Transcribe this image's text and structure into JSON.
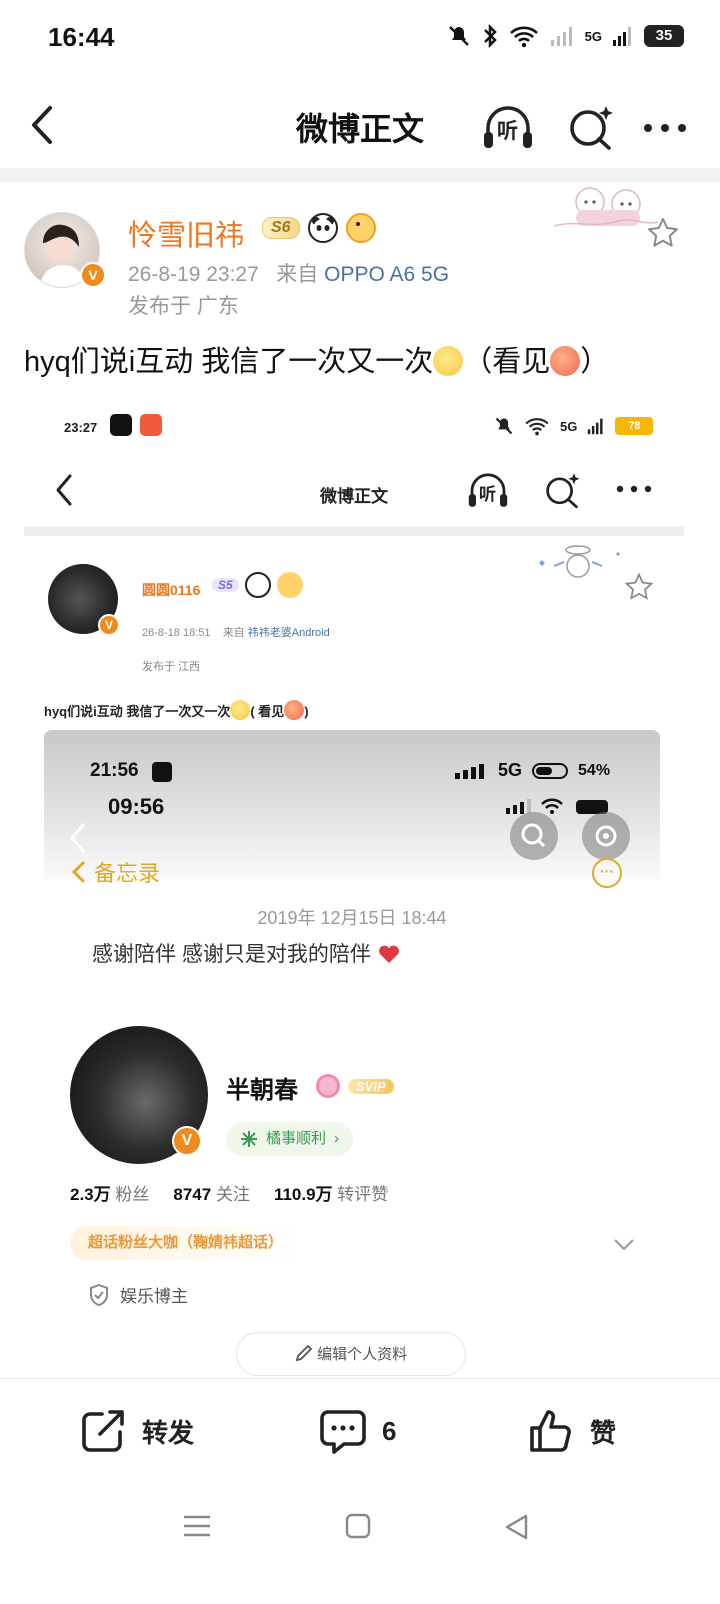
{
  "status_bar": {
    "time": "16:44",
    "network": "5G",
    "battery": "35"
  },
  "nav": {
    "title": "微博正文",
    "listen_label": "听"
  },
  "post": {
    "username": "怜雪旧祎",
    "level_badge": "S6",
    "timestamp": "26-8-19 23:27",
    "source_prefix": "来自",
    "source_device": "OPPO A6 5G",
    "location": "发布于 广东",
    "text": "hyq们说i互动 我信了一次又一次",
    "text_suffix_open": "（看见",
    "text_suffix_close": "）"
  },
  "embedded": {
    "status_time": "23:27",
    "network": "5G",
    "battery": "78",
    "nav_title": "微博正文",
    "listen_label": "听",
    "username": "圆圆0116",
    "level_badge": "S5",
    "timestamp": "26-8-18 18:51",
    "source_prefix": "来自",
    "source_device": "祎祎老婆Android",
    "location": "发布于 江西",
    "text": "hyq们说i互动 我信了一次又一次",
    "text_suffix_open": "( 看见",
    "text_suffix_close": ")",
    "memo": {
      "status_time_1": "21:56",
      "signal_1": "5G",
      "battery_1": "54%",
      "status_time_2": "09:56",
      "back_label": "备忘录",
      "date": "2019年 12月15日 18:44",
      "body": "感谢陪伴 感谢只是对我的陪伴"
    },
    "profile": {
      "name": "半朝春",
      "vip_badge": "SVIP",
      "pill": "橘事顺利",
      "stats": [
        {
          "value": "2.3万",
          "label": "粉丝"
        },
        {
          "value": "8747",
          "label": "关注"
        },
        {
          "value": "110.9万",
          "label": "转评赞"
        }
      ],
      "tag": "超话粉丝大咖（鞠婧祎超话）",
      "category": "娱乐博主",
      "edit_button": "编辑个人资料"
    }
  },
  "actions": {
    "repost": "转发",
    "comment_count": "6",
    "like": "赞"
  },
  "colors": {
    "accent_orange": "#f0741b",
    "link_blue": "#4a6fa5",
    "memo_gold": "#e0a92a"
  }
}
